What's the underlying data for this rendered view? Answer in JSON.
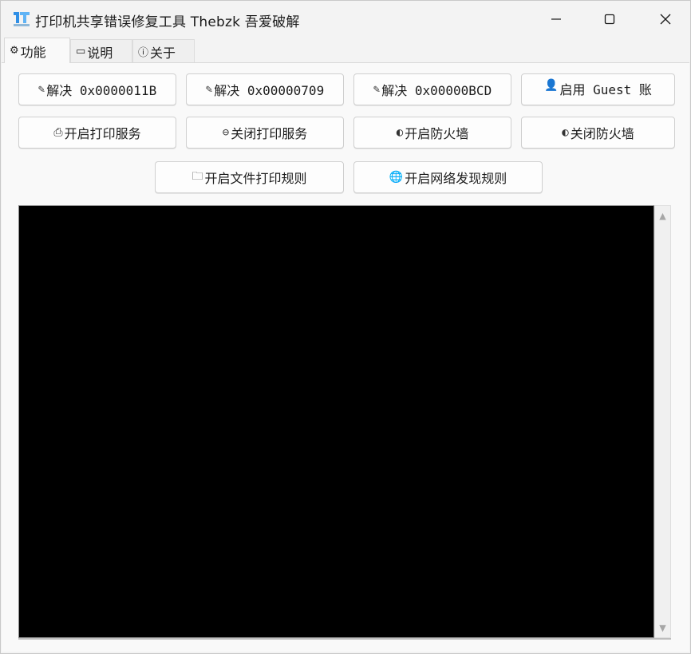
{
  "window": {
    "title": "打印机共享错误修复工具    Thebzk 吾爱破解",
    "controls": {
      "minimize": "minimize-icon",
      "maximize": "maximize-icon",
      "close": "close-icon"
    }
  },
  "tabs": [
    {
      "icon": "⚙",
      "label": "功能",
      "active": true
    },
    {
      "icon": "▭",
      "label": "说明",
      "active": false
    },
    {
      "icon": "ⓘ",
      "label": "关于",
      "active": false
    }
  ],
  "buttons": {
    "row1": [
      {
        "icon": "✎",
        "label": "解决 0x0000011B"
      },
      {
        "icon": "✎",
        "label": "解决 0x00000709"
      },
      {
        "icon": "✎",
        "label": "解决 0x00000BCD"
      },
      {
        "icon": "👤",
        "label": "启用 Guest 账"
      }
    ],
    "row2": [
      {
        "icon": "⎙",
        "label": "开启打印服务"
      },
      {
        "icon": "⊖",
        "label": "关闭打印服务"
      },
      {
        "icon": "◐",
        "label": "开启防火墙"
      },
      {
        "icon": "◐",
        "label": "关闭防火墙"
      }
    ],
    "row3": [
      {
        "icon": "🗀",
        "label": "开启文件打印规则"
      },
      {
        "icon": "🌐",
        "label": "开启网络发现规则"
      }
    ]
  },
  "console": {
    "background": "#000000",
    "scroll_up": "▲",
    "scroll_down": "▼"
  },
  "colors": {
    "app_icon_primary": "#2f8fe6",
    "window_bg": "#f3f3f3",
    "panel_bg": "#f9f9f9"
  }
}
